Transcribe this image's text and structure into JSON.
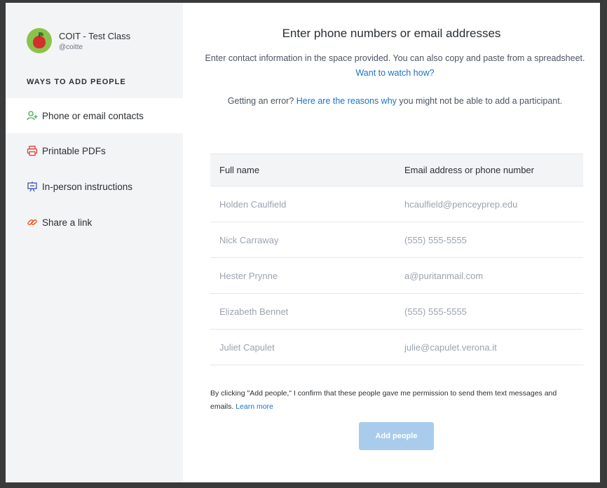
{
  "class": {
    "name": "COIT - Test Class",
    "handle": "@coitte"
  },
  "sidebar": {
    "section_title": "WAYS TO ADD PEOPLE",
    "items": [
      {
        "label": "Phone or email contacts",
        "icon": "add-person-icon",
        "active": true
      },
      {
        "label": "Printable PDFs",
        "icon": "printer-icon",
        "active": false
      },
      {
        "label": "In-person instructions",
        "icon": "presentation-board-icon",
        "active": false
      },
      {
        "label": "Share a link",
        "icon": "link-icon",
        "active": false
      }
    ]
  },
  "main": {
    "heading": "Enter phone numbers or email addresses",
    "intro": {
      "text": "Enter contact information in the space provided. You can also copy and paste from a spreadsheet.",
      "link": "Want to watch how?"
    },
    "error": {
      "prefix": "Getting an error?",
      "link": "Here are the reasons why",
      "suffix": "you might not be able to add a participant."
    },
    "table": {
      "columns": [
        "Full name",
        "Email address or phone number"
      ],
      "rows": [
        {
          "name": "Holden Caulfield",
          "contact": "hcaulfield@penceyprep.edu"
        },
        {
          "name": "Nick Carraway",
          "contact": "(555) 555-5555"
        },
        {
          "name": "Hester Prynne",
          "contact": "a@puritanmail.com"
        },
        {
          "name": "Elizabeth Bennet",
          "contact": "(555) 555-5555"
        },
        {
          "name": "Juliet Capulet",
          "contact": "julie@capulet.verona.it"
        }
      ]
    },
    "consent": {
      "text": "By clicking \"Add people,\" I confirm that these people gave me permission to send them text messages and emails.",
      "link": "Learn more"
    },
    "add_button": "Add people"
  },
  "colors": {
    "accent": "#1a73c8",
    "button_disabled": "#a9ccec",
    "sidebar_bg": "#f3f4f6"
  }
}
